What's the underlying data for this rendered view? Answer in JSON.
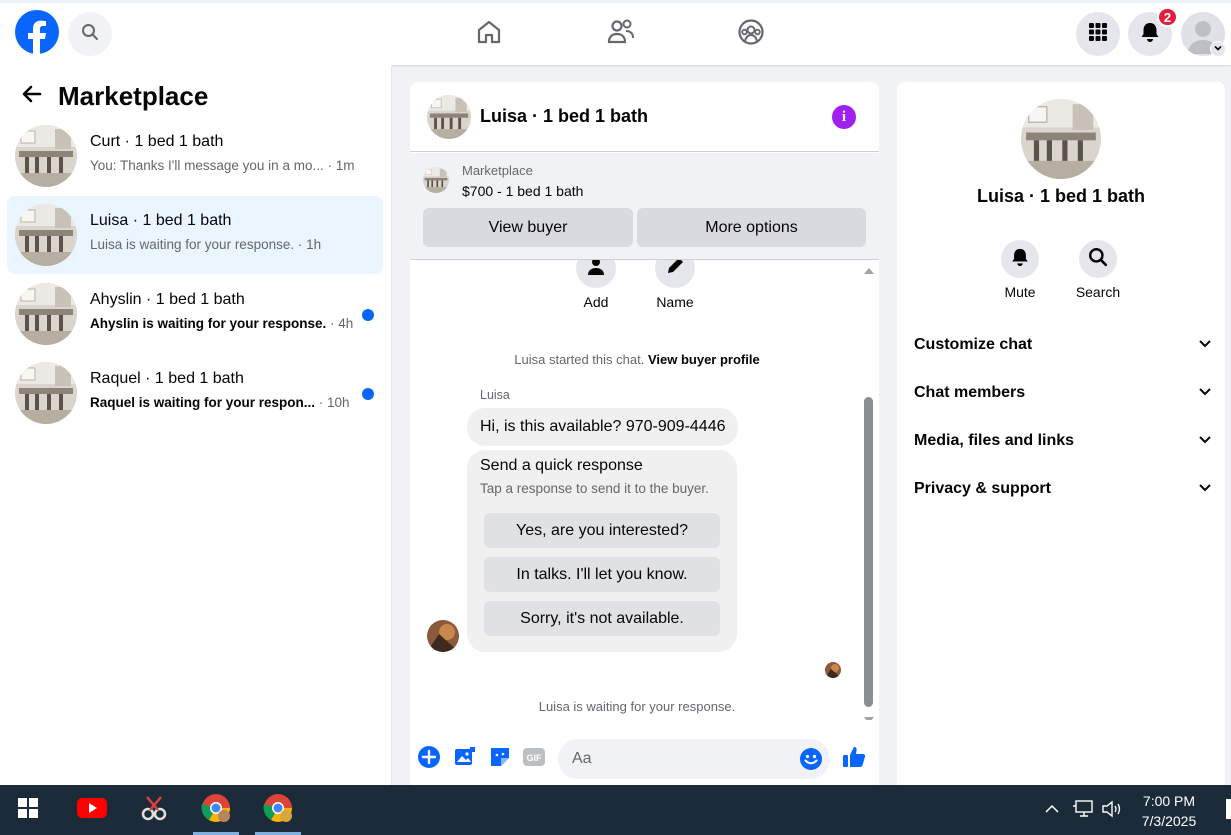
{
  "topnav": {
    "badge_count": "2",
    "icons": [
      "facebook-logo",
      "search-icon",
      "home-icon",
      "friends-icon",
      "groups-icon",
      "menu-grid-icon",
      "bell-icon",
      "profile-avatar",
      "chevron-down-icon"
    ]
  },
  "sidebar": {
    "title": "Marketplace",
    "conversations": [
      {
        "name": "Curt · 1 bed 1 bath",
        "snippet": "You: Thanks I'll message you in a mo...",
        "ago": " · 1m",
        "unread": false,
        "active": false
      },
      {
        "name": "Luisa · 1 bed 1 bath",
        "snippet": "Luisa is waiting for your response.",
        "ago": " · 1h",
        "unread": false,
        "active": true
      },
      {
        "name": "Ahyslin · 1 bed 1 bath",
        "snippet": "Ahyslin is waiting for your response.",
        "ago": " · 4h",
        "unread": true,
        "active": false
      },
      {
        "name": "Raquel · 1 bed 1 bath",
        "snippet": "Raquel is waiting for your respon...",
        "ago": " · 10h",
        "unread": true,
        "active": false
      }
    ]
  },
  "chat": {
    "title": "Luisa · 1 bed 1 bath",
    "listing": {
      "source": "Marketplace",
      "price_title": "$700 - 1 bed 1 bath",
      "view_buyer_label": "View buyer",
      "more_options_label": "More options"
    },
    "quick_actions": {
      "add_label": "Add",
      "name_label": "Name"
    },
    "started_note": "Luisa started this chat.",
    "view_profile_link": "View buyer profile",
    "sender_name": "Luisa",
    "message": "Hi, is this available? 970-909-4446",
    "quick_response": {
      "title": "Send a quick response",
      "subtitle": "Tap a response to send it to the buyer.",
      "options": [
        "Yes, are you interested?",
        "In talks. I'll let you know.",
        "Sorry, it's not available."
      ]
    },
    "waiting_note": "Luisa is waiting for your response.",
    "composer_placeholder": "Aa"
  },
  "details": {
    "title": "Luisa · 1 bed 1 bath",
    "mute_label": "Mute",
    "search_label": "Search",
    "sections": [
      "Customize chat",
      "Chat members",
      "Media, files and links",
      "Privacy & support"
    ]
  },
  "taskbar": {
    "time": "7:00 PM",
    "date": "7/3/2025"
  },
  "colors": {
    "accent": "#0866ff",
    "info": "#a020f0",
    "badge": "#e41e3f",
    "taskbar": "#1c2b39"
  }
}
